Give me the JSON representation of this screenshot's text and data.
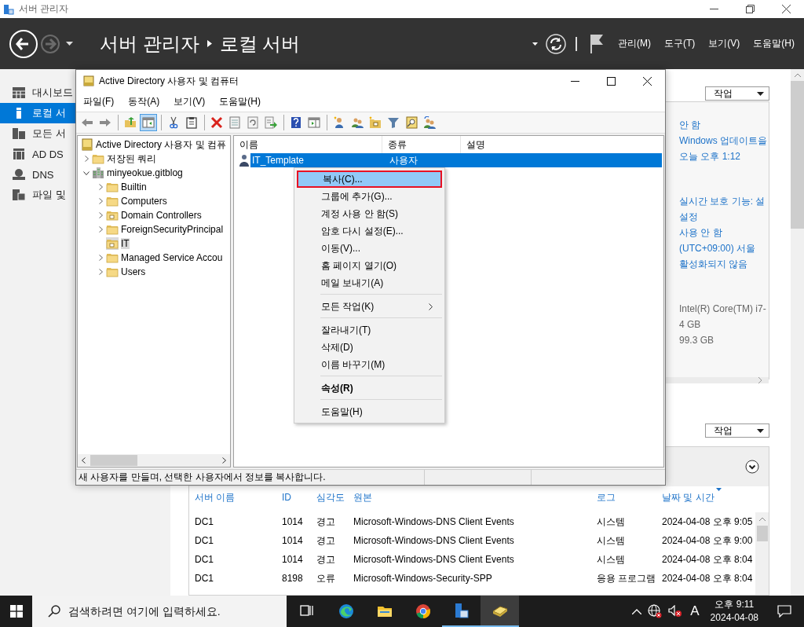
{
  "title_bar": {
    "title": "서버 관리자"
  },
  "header": {
    "back": {
      "disabled": false
    },
    "forward": {
      "disabled": true
    },
    "breadcrumb": [
      "서버 관리자",
      "로컬 서버"
    ],
    "menu": [
      "관리(M)",
      "도구(T)",
      "보기(V)",
      "도움말(H)"
    ]
  },
  "sidebar": {
    "items": [
      {
        "label": "대시보드",
        "kind": "dashboard",
        "selected": false
      },
      {
        "label": "로컬 서",
        "kind": "local",
        "selected": true
      },
      {
        "label": "모든 서",
        "kind": "all",
        "selected": false
      },
      {
        "label": "AD DS",
        "kind": "adds",
        "selected": false
      },
      {
        "label": "DNS",
        "kind": "dns",
        "selected": false
      },
      {
        "label": "파일 및",
        "kind": "files",
        "selected": false
      }
    ]
  },
  "properties": {
    "action_button": "작업",
    "groups": [
      {
        "values": [
          {
            "text": "안 함",
            "link": true
          },
          {
            "text": "Windows 업데이트을",
            "link": true
          },
          {
            "text": "오늘 오후 1:12",
            "link": true
          }
        ]
      },
      {
        "values": [
          {
            "text": "실시간 보호 기능: 설",
            "link": true
          },
          {
            "text": "설정",
            "link": true
          },
          {
            "text": "사용 안 함",
            "link": true
          },
          {
            "text": "(UTC+09:00) 서울",
            "link": true
          },
          {
            "text": "활성화되지 않음",
            "link": true
          }
        ]
      },
      {
        "values": [
          {
            "text": "Intel(R) Core(TM) i7-",
            "link": false
          },
          {
            "text": "4 GB",
            "link": false
          },
          {
            "text": "99.3 GB",
            "link": false
          }
        ]
      }
    ]
  },
  "events": {
    "action_button": "작업",
    "columns": [
      {
        "label": "서버 이름",
        "sorted": false
      },
      {
        "label": "ID",
        "sorted": false
      },
      {
        "label": "심각도",
        "sorted": false
      },
      {
        "label": "원본",
        "sorted": false
      },
      {
        "label": "로그",
        "sorted": false
      },
      {
        "label": "날짜 및 시간",
        "sorted": true
      }
    ],
    "rows": [
      [
        "DC1",
        "1014",
        "경고",
        "Microsoft-Windows-DNS Client Events",
        "시스템",
        "2024-04-08 오후 9:05"
      ],
      [
        "DC1",
        "1014",
        "경고",
        "Microsoft-Windows-DNS Client Events",
        "시스템",
        "2024-04-08 오후 9:00"
      ],
      [
        "DC1",
        "1014",
        "경고",
        "Microsoft-Windows-DNS Client Events",
        "시스템",
        "2024-04-08 오후 8:04"
      ],
      [
        "DC1",
        "8198",
        "오류",
        "Microsoft-Windows-Security-SPP",
        "응용 프로그램",
        "2024-04-08 오후 8:04"
      ]
    ]
  },
  "ad_window": {
    "title": "Active Directory 사용자 및 컴퓨터",
    "menu": [
      "파일(F)",
      "동작(A)",
      "보기(V)",
      "도움말(H)"
    ],
    "toolbar": [
      {
        "kind": "back",
        "on": false
      },
      {
        "kind": "forward",
        "on": false
      },
      {
        "kind": "sep"
      },
      {
        "kind": "up",
        "on": false
      },
      {
        "kind": "tree-toggle",
        "on": true
      },
      {
        "kind": "sep"
      },
      {
        "kind": "cut",
        "on": false
      },
      {
        "kind": "paste",
        "on": false
      },
      {
        "kind": "sep"
      },
      {
        "kind": "delete",
        "on": false
      },
      {
        "kind": "properties",
        "on": false
      },
      {
        "kind": "refresh",
        "on": false
      },
      {
        "kind": "export",
        "on": false
      },
      {
        "kind": "sep"
      },
      {
        "kind": "help",
        "on": false
      },
      {
        "kind": "view",
        "on": false
      },
      {
        "kind": "sep"
      },
      {
        "kind": "new-user",
        "on": false
      },
      {
        "kind": "new-group",
        "on": false
      },
      {
        "kind": "new-ou",
        "on": false
      },
      {
        "kind": "filter",
        "on": false
      },
      {
        "kind": "find",
        "on": false
      },
      {
        "kind": "add-to-group",
        "on": false
      }
    ],
    "tree": [
      {
        "label": "Active Directory 사용자 및 컴퓨",
        "kind": "root",
        "selected": false,
        "children": [
          {
            "label": "저장된 쿼리",
            "kind": "folder",
            "expandable": true,
            "expanded": false,
            "selected": false
          },
          {
            "label": "minyeokue.gitblog",
            "kind": "domain",
            "expandable": true,
            "expanded": true,
            "selected": false,
            "children": [
              {
                "label": "Builtin",
                "kind": "folder",
                "expandable": true,
                "expanded": false,
                "selected": false
              },
              {
                "label": "Computers",
                "kind": "folder",
                "expandable": true,
                "expanded": false,
                "selected": false
              },
              {
                "label": "Domain Controllers",
                "kind": "ou",
                "expandable": true,
                "expanded": false,
                "selected": false
              },
              {
                "label": "ForeignSecurityPrincipal",
                "kind": "folder",
                "expandable": true,
                "expanded": false,
                "selected": false
              },
              {
                "label": "IT",
                "kind": "ou",
                "expandable": false,
                "selected": true
              },
              {
                "label": "Managed Service Accou",
                "kind": "folder",
                "expandable": true,
                "expanded": false,
                "selected": false
              },
              {
                "label": "Users",
                "kind": "folder",
                "expandable": true,
                "expanded": false,
                "selected": false
              }
            ]
          }
        ]
      }
    ],
    "list": {
      "columns": [
        "이름",
        "종류",
        "설명"
      ],
      "rows": [
        {
          "name": "IT_Template",
          "type": "사용자",
          "selected": true
        }
      ]
    },
    "context_menu": [
      {
        "kind": "item",
        "label": "복사(C)...",
        "selected": true,
        "default": false,
        "submenu": false
      },
      {
        "kind": "item",
        "label": "그룹에 추가(G)...",
        "selected": false,
        "default": false,
        "submenu": false
      },
      {
        "kind": "item",
        "label": "계정 사용 안 함(S)",
        "selected": false,
        "default": false,
        "submenu": false
      },
      {
        "kind": "item",
        "label": "암호 다시 설정(E)...",
        "selected": false,
        "default": false,
        "submenu": false
      },
      {
        "kind": "item",
        "label": "이동(V)...",
        "selected": false,
        "default": false,
        "submenu": false
      },
      {
        "kind": "item",
        "label": "홈 페이지 열기(O)",
        "selected": false,
        "default": false,
        "submenu": false
      },
      {
        "kind": "item",
        "label": "메일 보내기(A)",
        "selected": false,
        "default": false,
        "submenu": false
      },
      {
        "kind": "separator"
      },
      {
        "kind": "item",
        "label": "모든 작업(K)",
        "selected": false,
        "default": false,
        "submenu": true
      },
      {
        "kind": "separator"
      },
      {
        "kind": "item",
        "label": "잘라내기(T)",
        "selected": false,
        "default": false,
        "submenu": false
      },
      {
        "kind": "item",
        "label": "삭제(D)",
        "selected": false,
        "default": false,
        "submenu": false
      },
      {
        "kind": "item",
        "label": "이름 바꾸기(M)",
        "selected": false,
        "default": false,
        "submenu": false
      },
      {
        "kind": "separator"
      },
      {
        "kind": "item",
        "label": "속성(R)",
        "selected": false,
        "default": true,
        "submenu": false
      },
      {
        "kind": "separator"
      },
      {
        "kind": "item",
        "label": "도움말(H)",
        "selected": false,
        "default": false,
        "submenu": false
      }
    ],
    "status_bar": "새 사용자를 만들며, 선택한 사용자에서 정보를 복사합니다."
  },
  "taskbar": {
    "search": {
      "placeholder": "검색하려면 여기에 입력하세요."
    },
    "apps": [
      {
        "kind": "task-view",
        "running": false,
        "active": false
      },
      {
        "kind": "edge",
        "running": false,
        "active": false
      },
      {
        "kind": "explorer",
        "running": false,
        "active": false
      },
      {
        "kind": "chrome",
        "running": false,
        "active": false
      },
      {
        "kind": "server-manager",
        "running": true,
        "active": false
      },
      {
        "kind": "ad-tool",
        "running": true,
        "active": true
      }
    ],
    "ime": "A",
    "time": "오후 9:11",
    "date": "2024-04-08"
  }
}
